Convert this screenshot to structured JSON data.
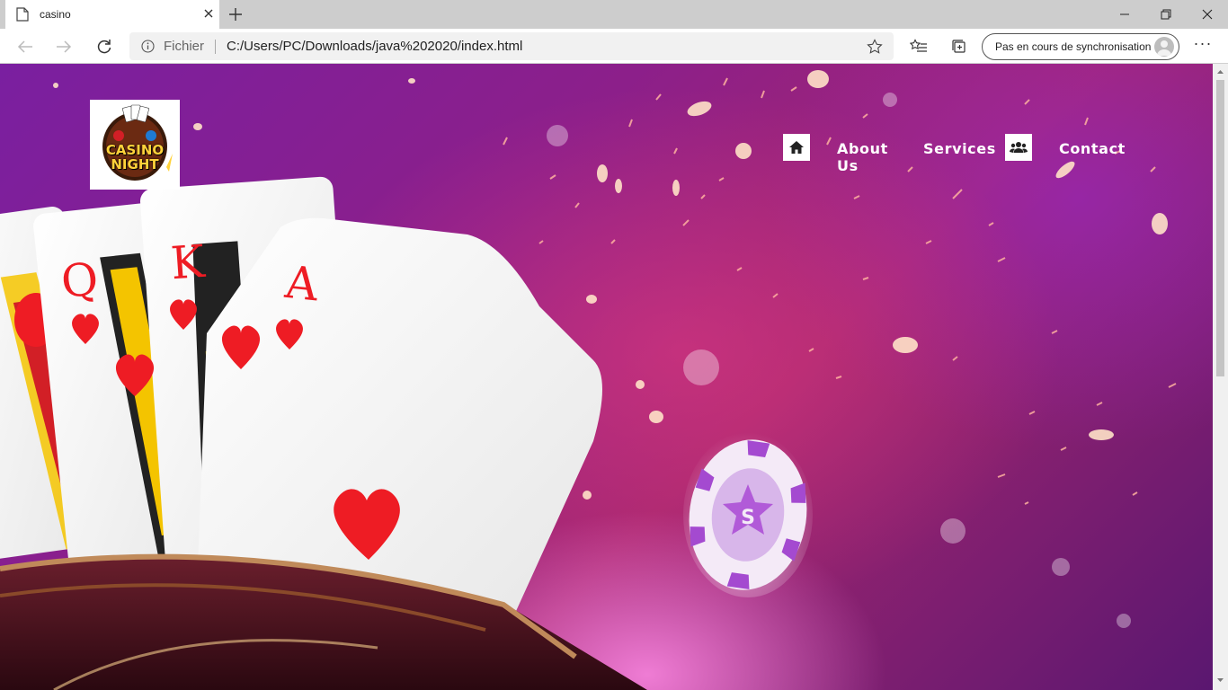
{
  "browser": {
    "tab_title": "casino",
    "address_label": "Fichier",
    "url": "C:/Users/PC/Downloads/java%202020/index.html",
    "sync_label": "Pas en cours de synchronisation"
  },
  "site": {
    "logo": {
      "line1": "CASINO",
      "line2": "NIGHT"
    },
    "nav": {
      "about": "About Us",
      "services": "Services",
      "contact": "Contact"
    }
  },
  "cards": {
    "queen_rank": "Q",
    "king_rank": "K",
    "ace_rank": "A"
  },
  "colors": {
    "card_red": "#ee1c24",
    "logo_gold": "#ffd23a",
    "bg_purple": "#7a1fa0",
    "bg_magenta": "#a3266f"
  }
}
